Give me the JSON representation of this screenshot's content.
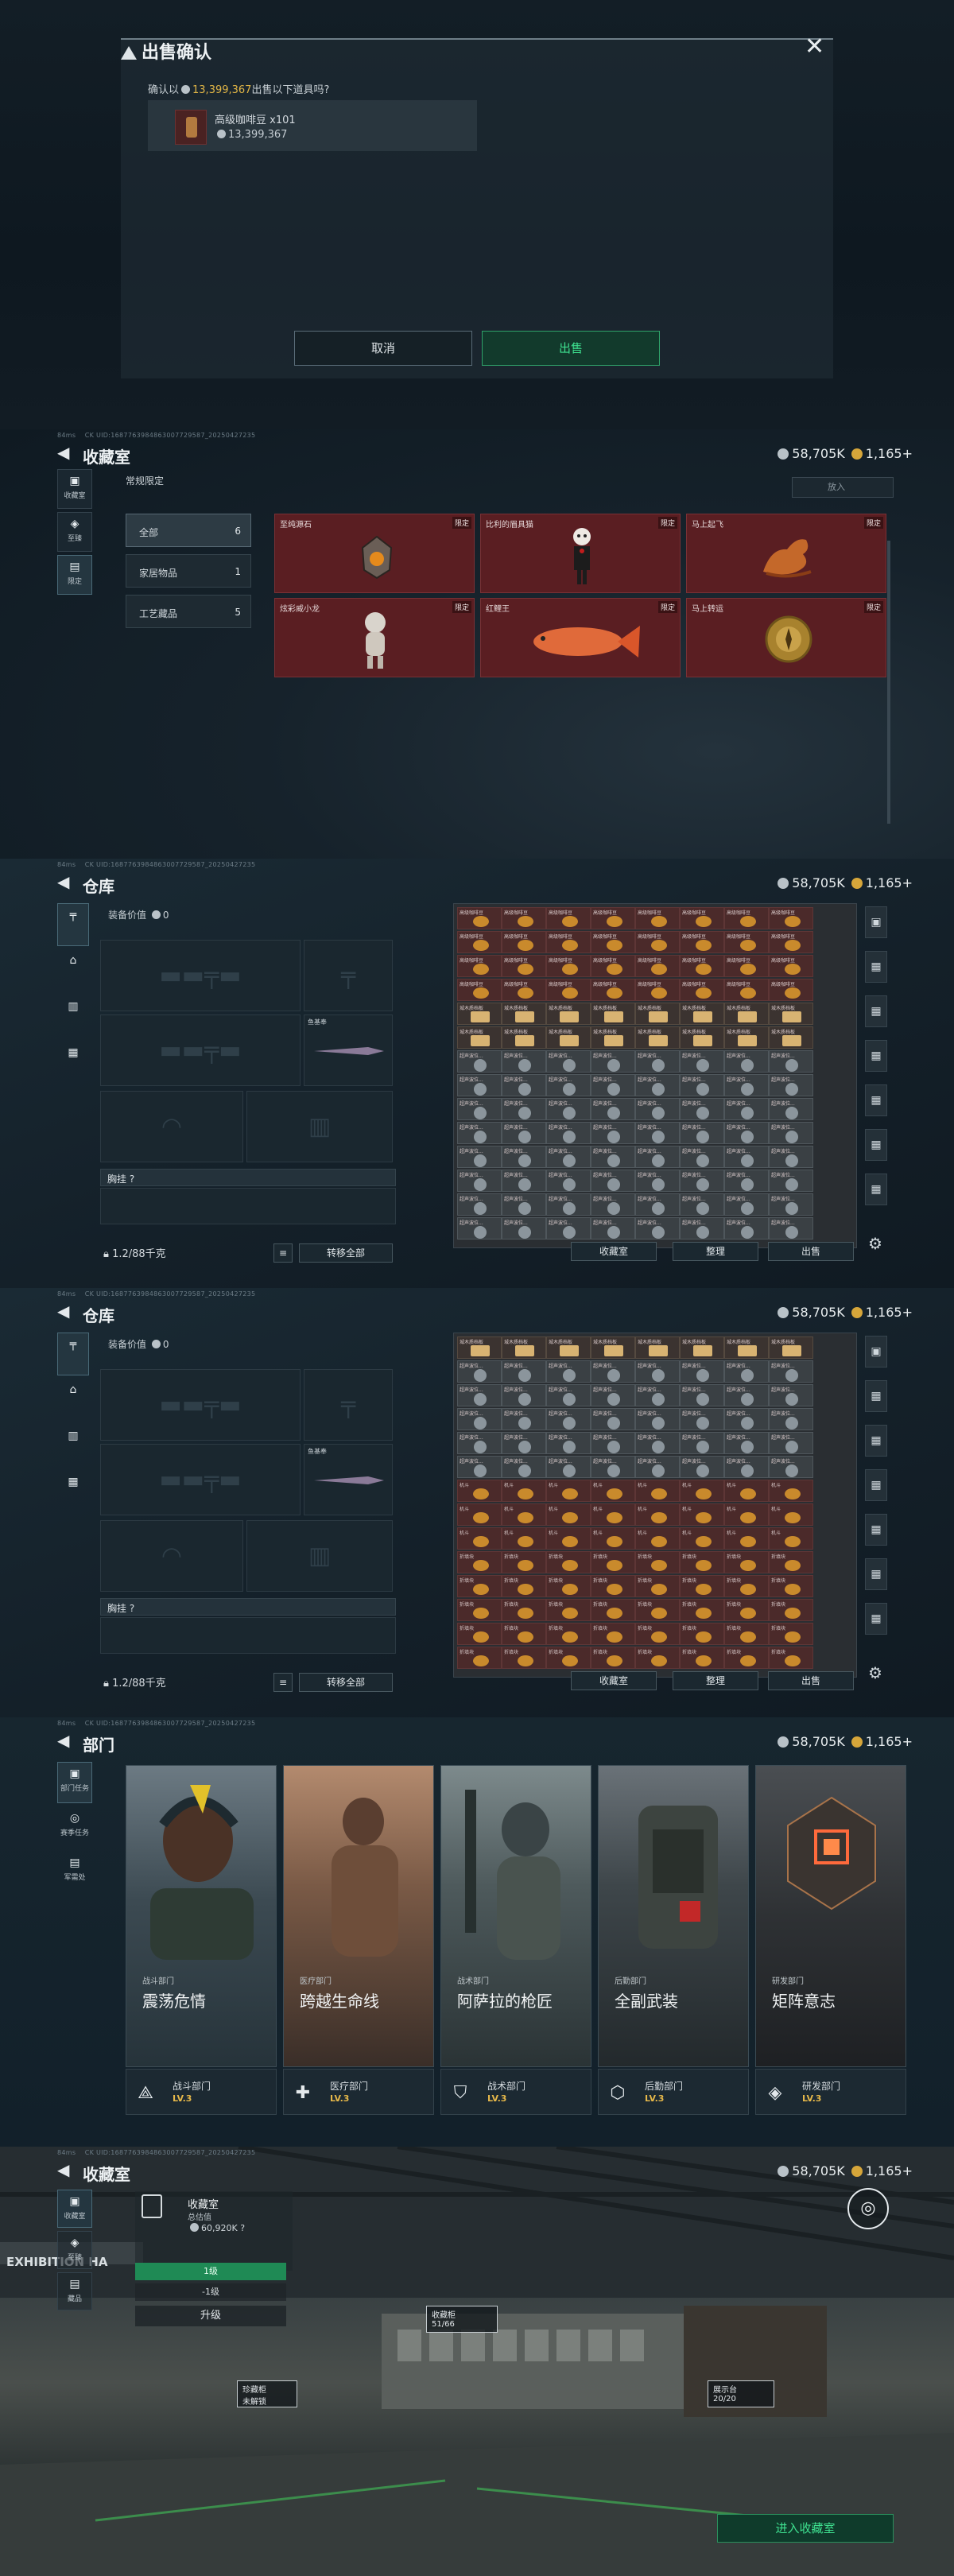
{
  "status": {
    "ping": "84ms",
    "uid": "CK UID:1687763984863007729587_20250427235"
  },
  "currency": {
    "silver": "58,705K",
    "gold": "1,165+"
  },
  "sell_dialog": {
    "title": "出售确认",
    "question_prefix": "确认以",
    "question_amount": "13,399,367",
    "question_suffix": "出售以下道具吗?",
    "item_name": "高级咖啡豆 x101",
    "item_value": "13,399,367",
    "cancel": "取消",
    "confirm": "出售"
  },
  "collection": {
    "title": "收藏室",
    "tabs": [
      "收藏室",
      "至臻",
      "限定"
    ],
    "section": "常规限定",
    "search_placeholder": "放入",
    "categories": [
      {
        "label": "全部",
        "count": "6"
      },
      {
        "label": "家居物品",
        "count": "1"
      },
      {
        "label": "工艺藏品",
        "count": "5"
      }
    ],
    "items": [
      {
        "name": "至纯源石",
        "tag": "限定"
      },
      {
        "name": "比利的眉具猫",
        "tag": "限定"
      },
      {
        "name": "马上起飞",
        "tag": "限定"
      },
      {
        "name": "炫彩威小龙",
        "tag": "限定"
      },
      {
        "name": "红鲤王",
        "tag": "限定"
      },
      {
        "name": "马上转运",
        "tag": "限定"
      }
    ]
  },
  "warehouse": {
    "title": "仓库",
    "equip_value_label": "装备价值",
    "equip_value": "0",
    "melee_name": "鱼基奉",
    "chest_label": "胸挂",
    "capacity": "1.2/88千克",
    "transfer_all": "转移全部",
    "btn_collection": "收藏室",
    "btn_sort": "整理",
    "btn_sell": "出售",
    "cell_coffee": "高级咖啡豆",
    "cell_bread": "城木质档板",
    "cell_misc": "超声波位...",
    "cell_head": "机斗",
    "cell_shell": "折填块"
  },
  "department": {
    "title": "部门",
    "tabs": [
      "部门任务",
      "赛季任务",
      "军需处"
    ],
    "cards": [
      {
        "sub": "战斗部门",
        "name": "震荡危情",
        "dept": "战斗部门",
        "level": "LV.3"
      },
      {
        "sub": "医疗部门",
        "name": "跨越生命线",
        "dept": "医疗部门",
        "level": "LV.3"
      },
      {
        "sub": "战术部门",
        "name": "阿萨拉的枪匠",
        "dept": "战术部门",
        "level": "LV.3"
      },
      {
        "sub": "后勤部门",
        "name": "全副武装",
        "dept": "后勤部门",
        "level": "LV.3"
      },
      {
        "sub": "研发部门",
        "name": "矩阵意志",
        "dept": "研发部门",
        "level": "LV.3"
      }
    ]
  },
  "base": {
    "title": "收藏室",
    "tabs": [
      "收藏室",
      "至臻",
      "藏品"
    ],
    "info_title": "收藏室",
    "info_label": "总估值",
    "info_value": "60,920K",
    "level_a": "1级",
    "level_b": "-1级",
    "upgrade": "升级",
    "exhibition": "EXHIBITION HA",
    "tag1_title": "收藏柜",
    "tag1_value": "51/66",
    "tag2_title": "展示台",
    "tag2_value": "20/20",
    "tag3_title": "珍藏柜",
    "tag3_value": "未解锁",
    "enter": "进入收藏室"
  },
  "colors": {
    "accent": "#3ee08f",
    "gold": "#e0b546",
    "limited_red": "#5a1e22"
  }
}
